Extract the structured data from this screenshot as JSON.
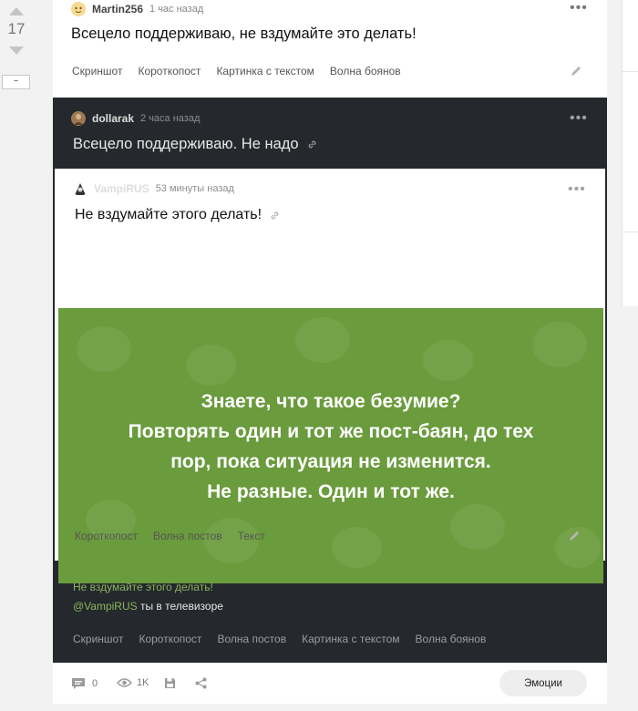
{
  "votes": {
    "count": "17",
    "collapse_label": "−"
  },
  "comment1": {
    "author": "Martin256",
    "time": "1 час назад",
    "text": "Всецело поддерживаю, не вздумайте это делать!",
    "tags": [
      "Скриншот",
      "Короткопост",
      "Картинка с текстом",
      "Волна боянов"
    ]
  },
  "comment2": {
    "author": "dollarak",
    "time": "2 часа назад",
    "title": "Всецело поддерживаю. Не надо",
    "quote": "Не вздумайте этого делать!",
    "mention": "@VampiRUS",
    "mention_tail": " ты в телевизоре",
    "tags": [
      "Скриншот",
      "Короткопост",
      "Волна постов",
      "Картинка с текстом",
      "Волна боянов"
    ]
  },
  "inner_post": {
    "author": "VampiRUS",
    "time": "53 минуты назад",
    "title": "Не вздумайте этого делать!",
    "image_lines": [
      "Знаете, что такое безумие?",
      "Повторять один и тот же пост-баян, до тех",
      "пор, пока ситуация не изменится.",
      "Не разные. Один и тот же."
    ],
    "tags": [
      "Короткопост",
      "Волна постов",
      "Текст"
    ]
  },
  "footer": {
    "comments": "0",
    "views": "1K",
    "emotions_label": "Эмоции"
  },
  "colors": {
    "dark_bg": "#25282c",
    "image_green": "#6a9b3c",
    "quote_green": "#8ab45e"
  },
  "icons": [
    "pencil-icon",
    "link-icon",
    "comment-icon",
    "eye-icon",
    "save-icon",
    "share-icon",
    "more-dots-icon"
  ]
}
